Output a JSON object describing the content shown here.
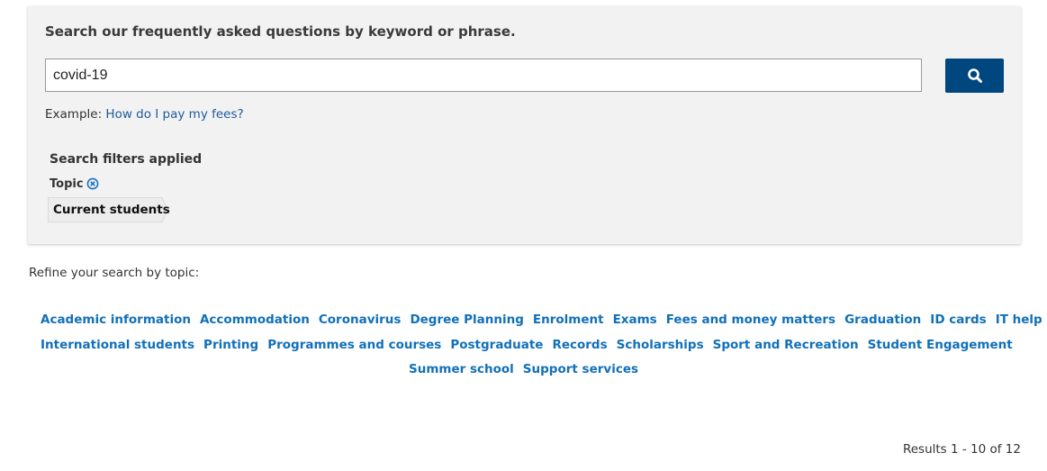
{
  "search": {
    "heading": "Search our frequently asked questions by keyword or phrase.",
    "value": "covid-19",
    "button_icon": "search-icon",
    "example_prefix": "Example:",
    "example_link": "How do I pay my fees?"
  },
  "filters": {
    "heading": "Search filters applied",
    "group_label": "Topic",
    "remove_icon": "close-circle-icon",
    "chips": [
      "Current students"
    ]
  },
  "refine": {
    "label": "Refine your search by topic:",
    "topics": [
      [
        "Academic information",
        "Accommodation",
        "Coronavirus",
        "Degree Planning",
        "Enrolment",
        "Exams",
        "Fees and money matters",
        "Graduation",
        "ID cards",
        "IT help"
      ],
      [
        "International students",
        "Printing",
        "Programmes and courses",
        "Postgraduate",
        "Records",
        "Scholarships",
        "Sport and Recreation",
        "Student Engagement"
      ],
      [
        "Summer school",
        "Support services"
      ]
    ]
  },
  "results": {
    "summary": "Results 1 - 10 of 12"
  },
  "colors": {
    "panel_bg": "#f2f2f2",
    "button_bg": "#00467f",
    "link": "#1170b8",
    "example_link": "#1e5b9a",
    "remove_icon": "#1a73c2"
  }
}
